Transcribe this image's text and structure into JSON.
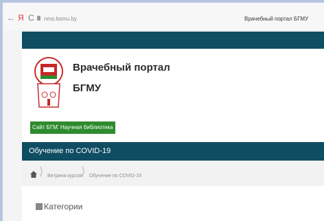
{
  "browser": {
    "back_icon": "←",
    "yandex_icon": "Я",
    "reload_icon": "C",
    "url": "nmo.bsmu.by",
    "tab_title": "Врачебный портал БГМУ"
  },
  "site": {
    "name_line1": "Врачебный портал",
    "name_line2": "БГМУ",
    "buttons": [
      "Сайт БГМУ",
      "Научная библиотека"
    ],
    "accent_color": "#0f4d63",
    "button_color": "#2e8b2e"
  },
  "course": {
    "title": "Обучение по COVID-19"
  },
  "breadcrumb": {
    "items": [
      "Витрина курсов",
      "Обучение по COVID-19"
    ]
  },
  "section": {
    "label": "Категории"
  }
}
